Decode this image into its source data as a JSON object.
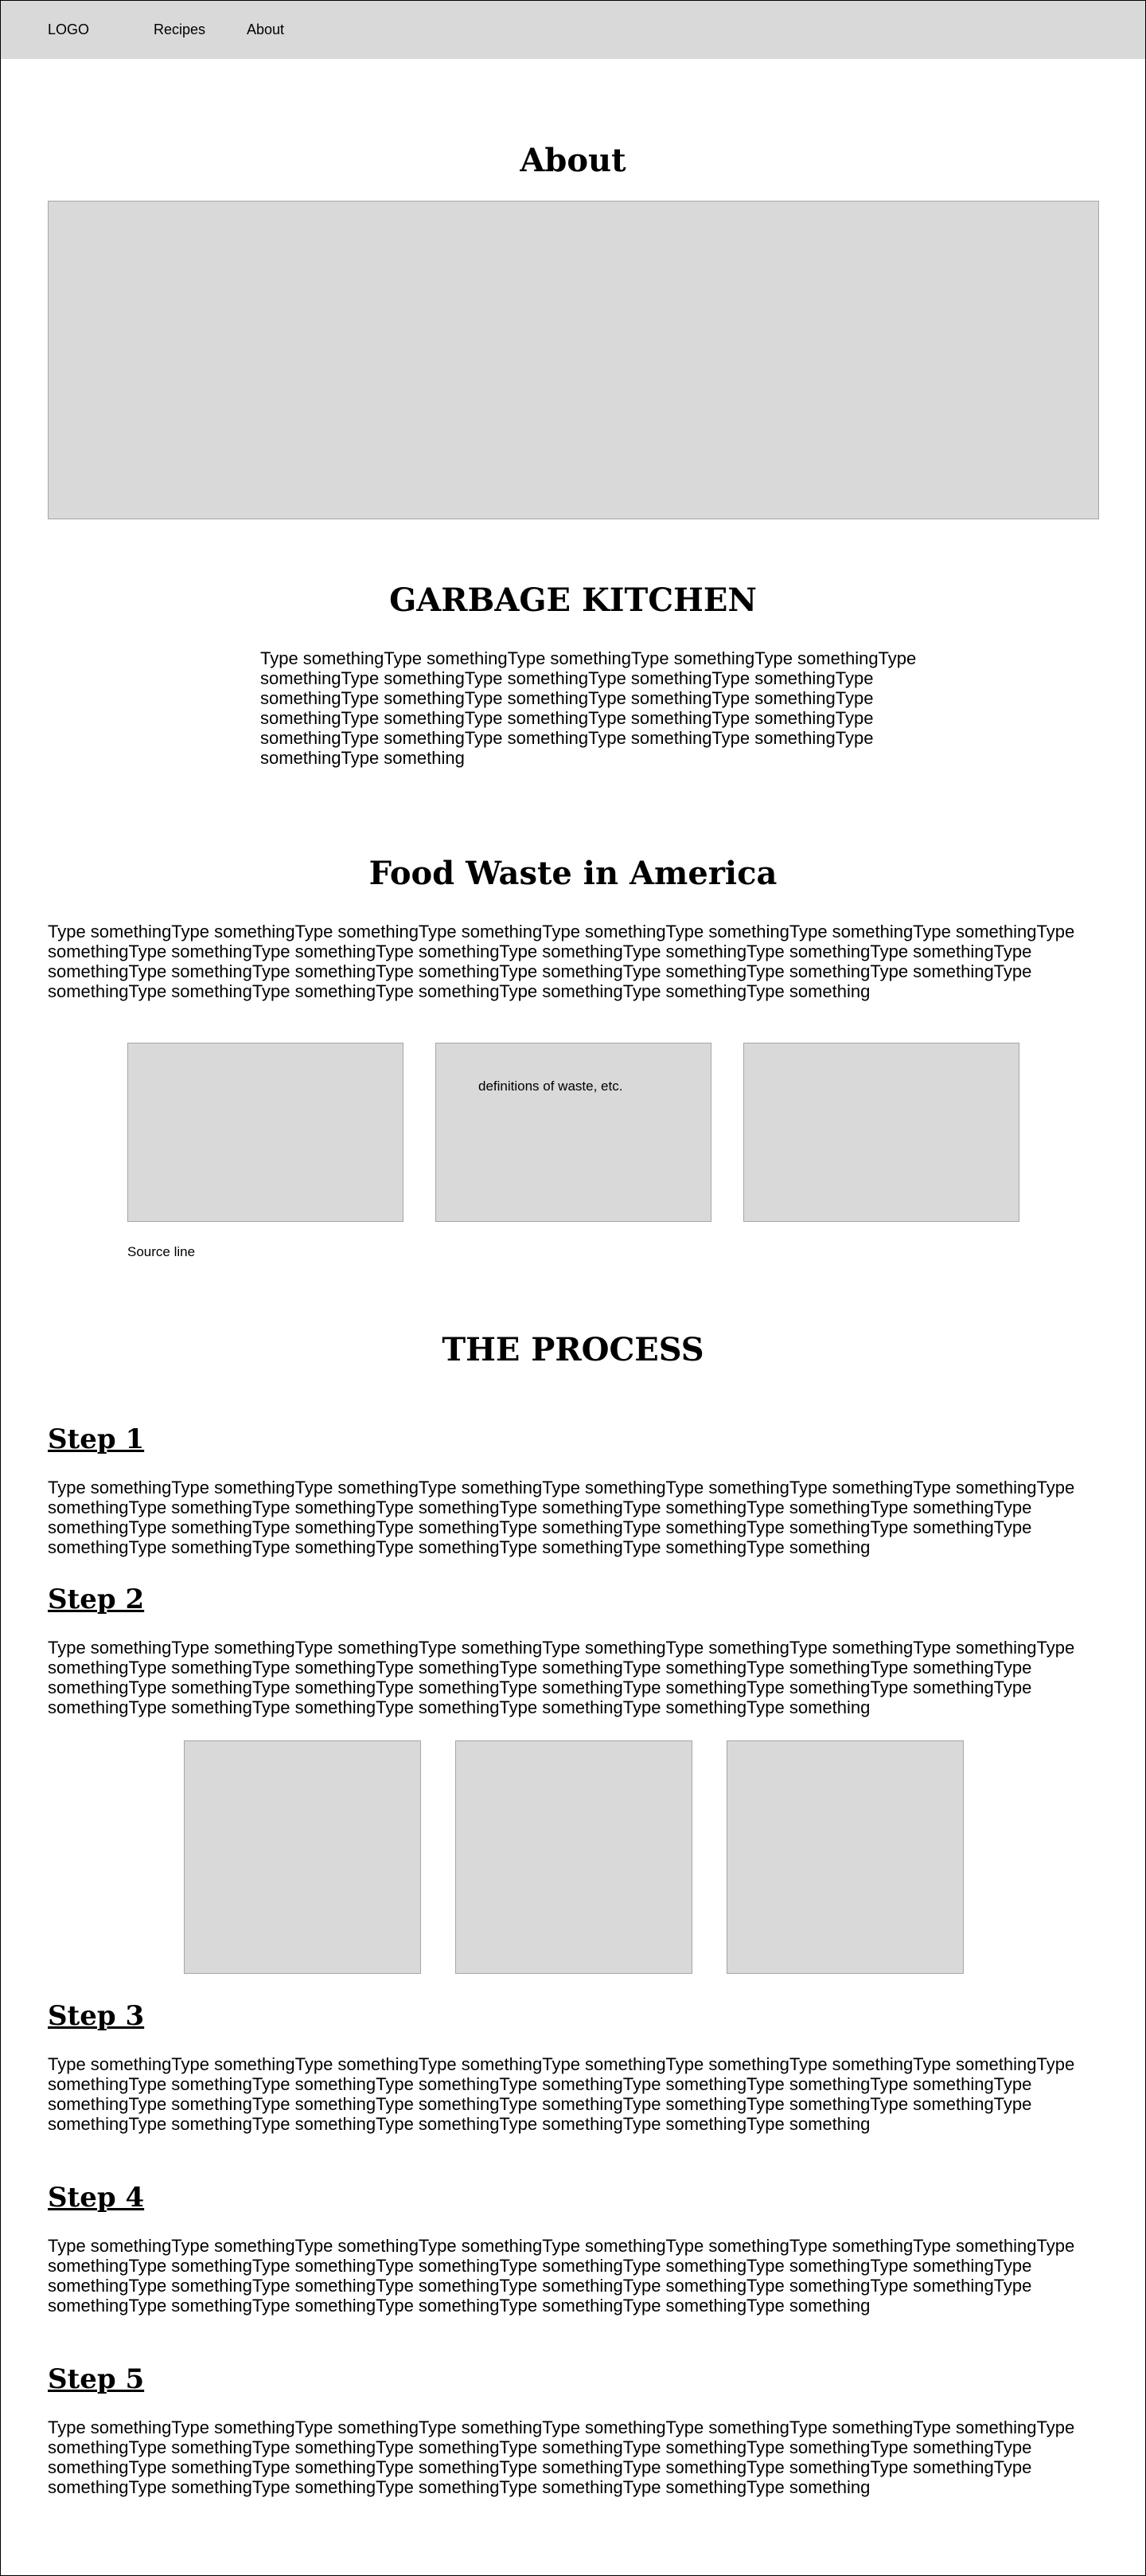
{
  "nav": {
    "logo": "LOGO",
    "links": [
      "Recipes",
      "About"
    ]
  },
  "about": {
    "title": "About"
  },
  "garbage_kitchen": {
    "title": "GARBAGE KITCHEN",
    "body": "Type somethingType somethingType somethingType somethingType somethingType somethingType somethingType somethingType somethingType somethingType somethingType somethingType somethingType somethingType somethingType somethingType somethingType somethingType somethingType somethingType somethingType somethingType somethingType somethingType somethingType somethingType something"
  },
  "food_waste": {
    "title": "Food Waste in America",
    "body": "Type somethingType somethingType somethingType somethingType somethingType somethingType somethingType somethingType somethingType somethingType somethingType somethingType somethingType somethingType somethingType somethingType somethingType somethingType somethingType somethingType somethingType somethingType somethingType somethingType somethingType somethingType somethingType somethingType somethingType somethingType something",
    "box_caption": "definitions of waste, etc.",
    "source": "Source line"
  },
  "process": {
    "title": "THE PROCESS",
    "steps": [
      {
        "title": "Step 1",
        "body": "Type somethingType somethingType somethingType somethingType somethingType somethingType somethingType somethingType somethingType somethingType somethingType somethingType somethingType somethingType somethingType somethingType somethingType somethingType somethingType somethingType somethingType somethingType somethingType somethingType somethingType somethingType somethingType somethingType somethingType somethingType something"
      },
      {
        "title": "Step 2",
        "body": "Type somethingType somethingType somethingType somethingType somethingType somethingType somethingType somethingType somethingType somethingType somethingType somethingType somethingType somethingType somethingType somethingType somethingType somethingType somethingType somethingType somethingType somethingType somethingType somethingType somethingType somethingType somethingType somethingType somethingType somethingType something"
      },
      {
        "title": "Step 3",
        "body": "Type somethingType somethingType somethingType somethingType somethingType somethingType somethingType somethingType somethingType somethingType somethingType somethingType somethingType somethingType somethingType somethingType somethingType somethingType somethingType somethingType somethingType somethingType somethingType somethingType somethingType somethingType somethingType somethingType somethingType somethingType something"
      },
      {
        "title": "Step 4",
        "body": "Type somethingType somethingType somethingType somethingType somethingType somethingType somethingType somethingType somethingType somethingType somethingType somethingType somethingType somethingType somethingType somethingType somethingType somethingType somethingType somethingType somethingType somethingType somethingType somethingType somethingType somethingType somethingType somethingType somethingType somethingType something"
      },
      {
        "title": "Step 5",
        "body": "Type somethingType somethingType somethingType somethingType somethingType somethingType somethingType somethingType somethingType somethingType somethingType somethingType somethingType somethingType somethingType somethingType somethingType somethingType somethingType somethingType somethingType somethingType somethingType somethingType somethingType somethingType somethingType somethingType somethingType somethingType something"
      }
    ]
  }
}
